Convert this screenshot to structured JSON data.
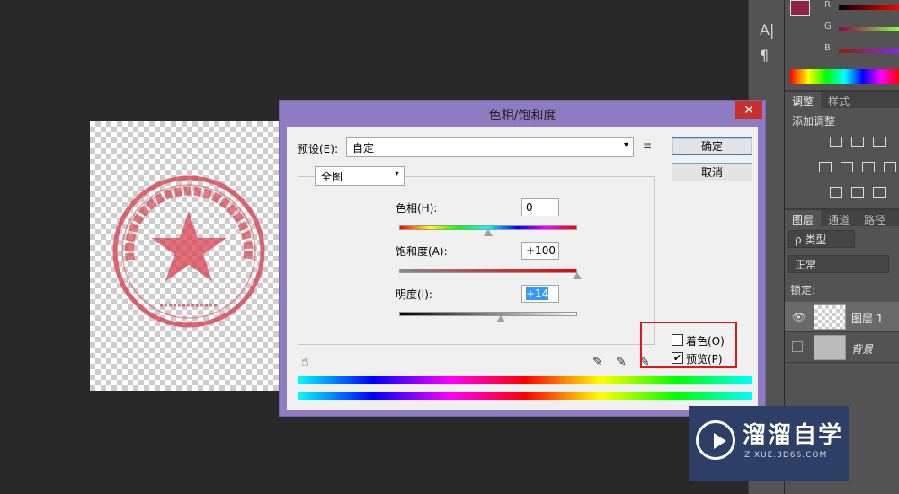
{
  "dialog": {
    "title": "色相/饱和度",
    "close_label": "✕",
    "preset_label": "预设(E):",
    "preset_value": "自定",
    "ok_label": "确定",
    "cancel_label": "取消",
    "channel_value": "全图",
    "hue_label": "色相(H):",
    "hue_value": "0",
    "saturation_label": "饱和度(A):",
    "saturation_value": "+100",
    "lightness_label": "明度(I):",
    "lightness_value": "+14",
    "colorize_label": "着色(O)",
    "colorize_checked": false,
    "preview_label": "预览(P)",
    "preview_checked": true,
    "check_mark": "✔",
    "slider_positions": {
      "hue": 0.5,
      "saturation": 1.0,
      "lightness": 0.57
    },
    "accent_color": "#8f7bc2"
  },
  "right_panels": {
    "color_channels": [
      "R",
      "G",
      "B"
    ],
    "adjust_tabs": [
      "调整",
      "样式"
    ],
    "adjust_title": "添加调整",
    "layers_tabs": [
      "图层",
      "通道",
      "路径"
    ],
    "filter_kind": "ρ 类型",
    "blend_mode": "正常",
    "lock_label": "锁定:",
    "layers": [
      {
        "name": "图层 1",
        "visible": true,
        "selected": true
      },
      {
        "name": "背景",
        "visible": false,
        "selected": false
      }
    ],
    "tool_icons": [
      "A|",
      "¶"
    ]
  },
  "watermark": {
    "title": "溜溜自学",
    "subtitle": "ZIXUE.3D66.COM"
  }
}
